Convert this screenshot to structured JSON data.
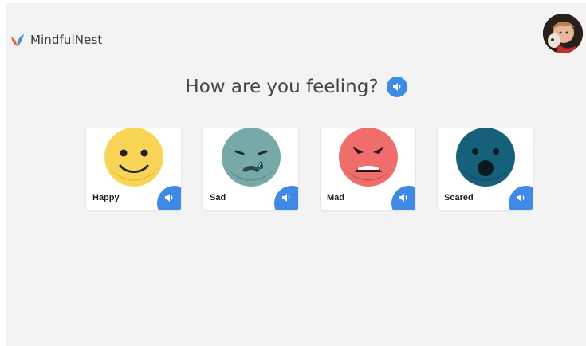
{
  "app": {
    "name": "MindfulNest"
  },
  "prompt": {
    "title": "How are you feeling?"
  },
  "emotions": [
    {
      "label": "Happy",
      "color": "#f9d557"
    },
    {
      "label": "Sad",
      "color": "#76a9a8"
    },
    {
      "label": "Mad",
      "color": "#ef6d6a"
    },
    {
      "label": "Scared",
      "color": "#17607c"
    }
  ],
  "colors": {
    "accent": "#3f8ae6",
    "background": "#f3f3f3"
  },
  "icons": {
    "speaker": "speaker-icon",
    "logo": "leaf-logo-icon"
  }
}
